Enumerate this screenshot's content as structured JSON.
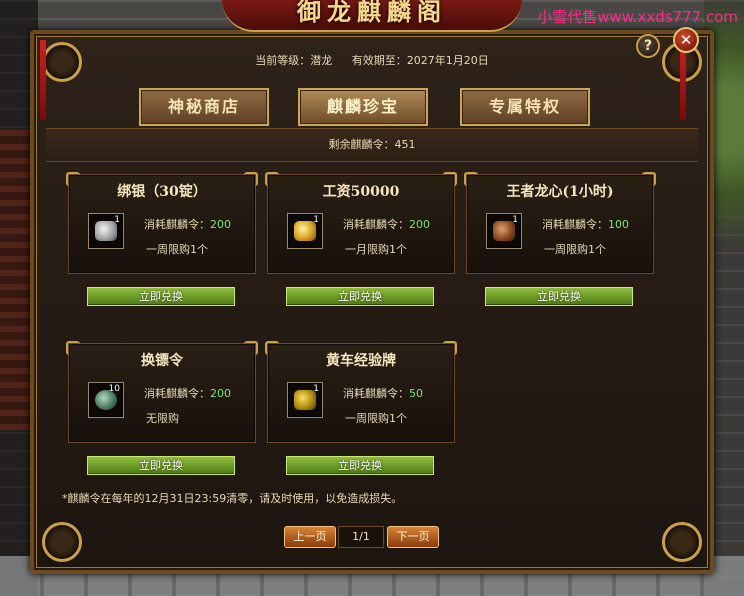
{
  "header": {
    "title": "御龙麒麟阁",
    "watermark": "小雪代售www.xxds777.com"
  },
  "info": {
    "level_label": "当前等级：潜龙",
    "expiry_label": "有效期至：2027年1月20日"
  },
  "tabs": [
    {
      "label": "神秘商店"
    },
    {
      "label": "麒麟珍宝",
      "active": true
    },
    {
      "label": "专属特权"
    }
  ],
  "remaining": "剩余麒麟令：451",
  "cost_prefix": "消耗麒麟令：",
  "items": [
    {
      "name": "绑银（30锭）",
      "icon": "silver-ingot-icon",
      "qty": "1",
      "cost": "200",
      "limit": "一周限购1个",
      "button": "立即兑换"
    },
    {
      "name": "工资50000",
      "icon": "gold-coins-icon",
      "qty": "1",
      "cost": "200",
      "limit": "一月限购1个",
      "button": "立即兑换"
    },
    {
      "name": "王者龙心(1小时)",
      "icon": "dragon-heart-icon",
      "qty": "1",
      "cost": "100",
      "limit": "一周限购1个",
      "button": "立即兑换"
    },
    {
      "name": "换镖令",
      "icon": "escort-token-icon",
      "qty": "10",
      "cost": "200",
      "limit": "无限购",
      "button": "立即兑换"
    },
    {
      "name": "黄车经验牌",
      "icon": "yellow-cart-card-icon",
      "qty": "1",
      "cost": "50",
      "limit": "一周限购1个",
      "button": "立即兑换"
    }
  ],
  "notice": "*麒麟令在每年的12月31日23:59清零，请及时使用，以免造成损失。",
  "pager": {
    "prev": "上一页",
    "page": "1/1",
    "next": "下一页"
  },
  "buttons": {
    "help": "?",
    "close": "✕"
  },
  "colors": {
    "accent_gold": "#c9a14a",
    "cost_value_green": "#7fe07a",
    "redeem_green": "#6c9c26",
    "pager_orange": "#c0662a"
  }
}
